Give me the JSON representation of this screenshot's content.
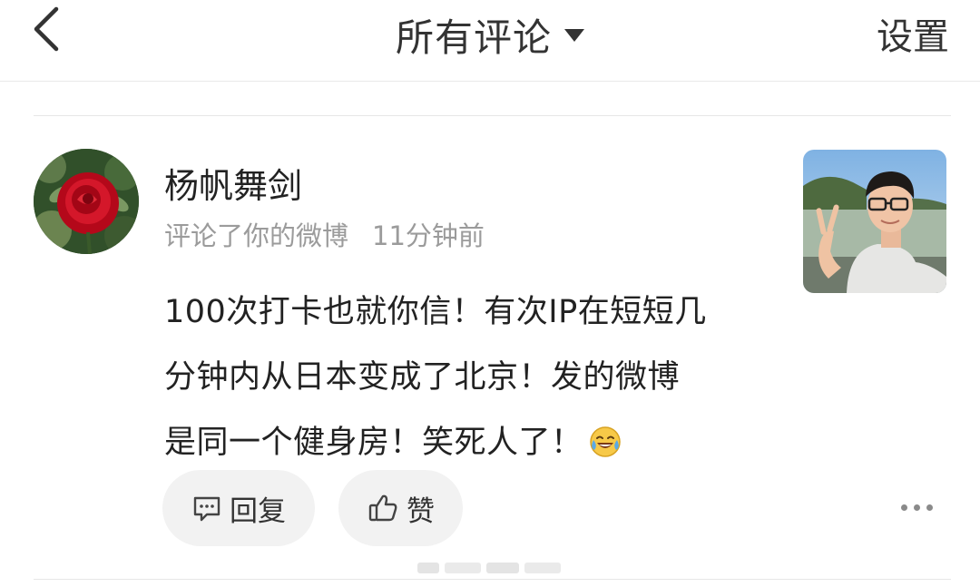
{
  "header": {
    "title": "所有评论",
    "settings_label": "设置"
  },
  "comment": {
    "username": "杨帆舞剑",
    "action": "评论了你的微博",
    "time": "11分钟前",
    "lines": [
      "100次打卡也就你信！有次IP在短短几",
      "分钟内从日本变成了北京！发的微博",
      "是同一个健身房！笑死人了！"
    ],
    "emoji": "laughing-tears-emoji"
  },
  "actions": {
    "reply_label": "回复",
    "like_label": "赞"
  },
  "colors": {
    "text": "#222222",
    "secondary": "#9b9b9b",
    "pill_bg": "#f2f2f2",
    "divider": "#e6e6e6"
  }
}
